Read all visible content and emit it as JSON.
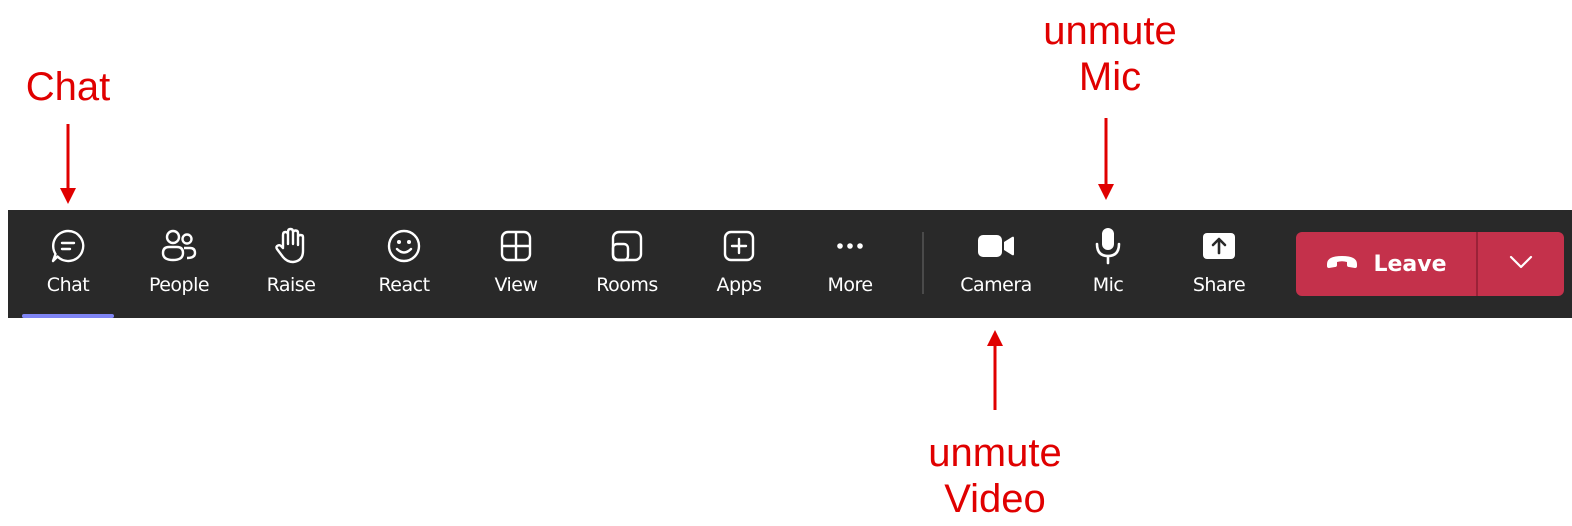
{
  "annotations": {
    "chat": "Chat",
    "mic_line1": "unmute",
    "mic_line2": "Mic",
    "video_line1": "unmute",
    "video_line2": "Video"
  },
  "toolbar": {
    "buttons": [
      {
        "label": "Chat",
        "icon": "chat-icon",
        "selected": true
      },
      {
        "label": "People",
        "icon": "people-icon"
      },
      {
        "label": "Raise",
        "icon": "raise-hand-icon"
      },
      {
        "label": "React",
        "icon": "smiley-icon"
      },
      {
        "label": "View",
        "icon": "grid-view-icon"
      },
      {
        "label": "Rooms",
        "icon": "rooms-icon"
      },
      {
        "label": "Apps",
        "icon": "apps-plus-icon"
      },
      {
        "label": "More",
        "icon": "more-dots-icon"
      },
      {
        "label": "Camera",
        "icon": "camera-icon"
      },
      {
        "label": "Mic",
        "icon": "microphone-icon"
      },
      {
        "label": "Share",
        "icon": "share-icon"
      }
    ],
    "leave_label": "Leave"
  },
  "colors": {
    "annotation": "#e00000",
    "toolbar_bg": "#292929",
    "leave_bg": "#c4314b",
    "selected_indicator": "#7f85f5"
  }
}
